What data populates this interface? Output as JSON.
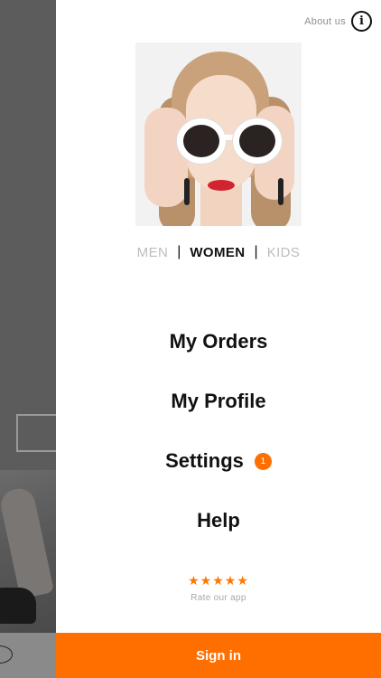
{
  "header": {
    "about_label": "About us",
    "info_icon": "info-icon"
  },
  "categories": {
    "men": "MEN",
    "women": "WOMEN",
    "kids": "KIDS",
    "separator": "|",
    "active": "WOMEN"
  },
  "menu": {
    "orders": "My Orders",
    "profile": "My Profile",
    "settings": "Settings",
    "settings_badge": "1",
    "help": "Help"
  },
  "rating": {
    "stars": "★★★★★",
    "label": "Rate our app",
    "star_color": "#ff7700"
  },
  "footer": {
    "signin_label": "Sign in",
    "accent": "#ff6f00"
  }
}
